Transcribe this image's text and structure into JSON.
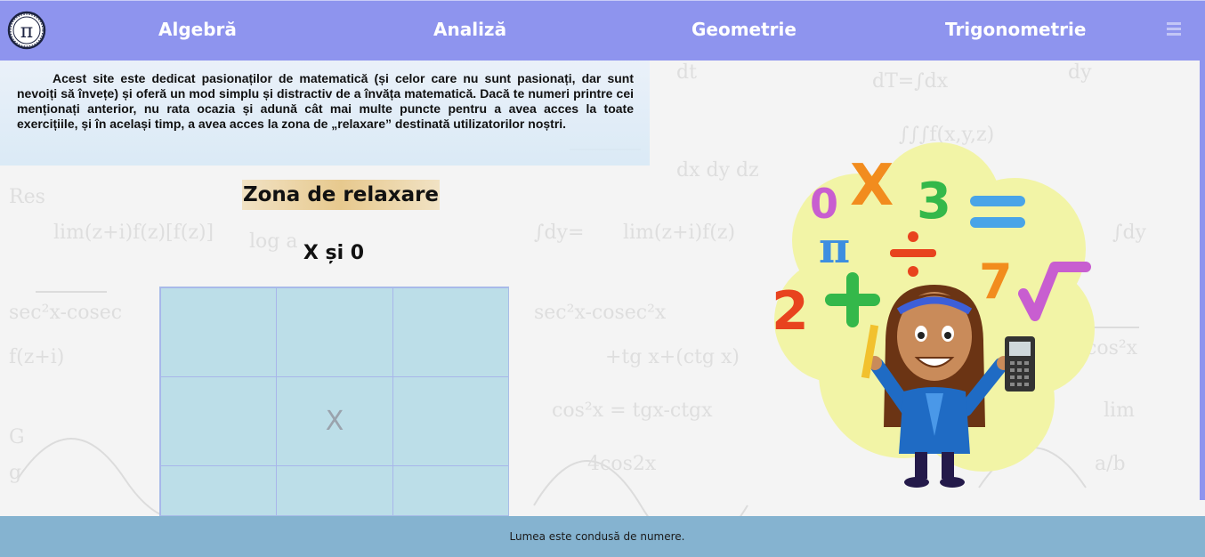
{
  "nav": {
    "items": [
      {
        "label": "Algebră"
      },
      {
        "label": "Analiză"
      },
      {
        "label": "Geometrie"
      },
      {
        "label": "Trigonometrie"
      }
    ],
    "logo_icon": "pi-logo-icon",
    "menu_icon": "hamburger-menu-icon"
  },
  "intro": {
    "text": "Acest site este dedicat pasionaților de matematică (și celor care nu sunt pasionați, dar sunt nevoiți să învețe) și oferă un mod simplu și distractiv de a învăța matematică. Dacă te numeri printre cei menționați anterior, nu rata ocazia și adună cât mai multe puncte pentru a avea acces la toate exercițiile, și în același timp, a avea acces la zona de „relaxare” destinată utilizatorilor noștri."
  },
  "relax": {
    "title": "Zona de relaxare",
    "game_title": "X și 0",
    "cells": [
      "",
      "",
      "",
      "",
      "X",
      "",
      "",
      "",
      ""
    ]
  },
  "illustration": {
    "icon": "math-girl-illustration"
  },
  "footer": {
    "text": "Lumea este condusă de numere."
  },
  "colors": {
    "nav_bg": "#8e94ee",
    "footer_bg": "#85b3d0",
    "board_bg": "#bcdee8"
  }
}
